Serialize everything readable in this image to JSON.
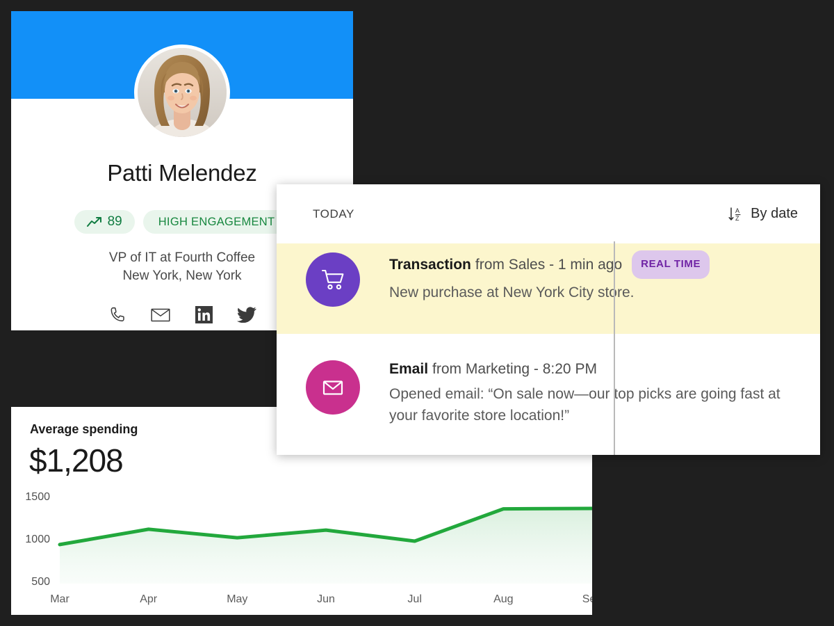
{
  "profile": {
    "name": "Patti Melendez",
    "score_badge": {
      "icon": "trend-up-icon",
      "value": "89"
    },
    "engagement_badge": "HIGH ENGAGEMENT",
    "title_line": "VP of IT at Fourth Coffee",
    "location_line": "New York, New York",
    "banner_color": "#1290f8",
    "badge_text_color": "#107c41",
    "badge_bg_color": "#e9f5ec",
    "social": [
      {
        "name": "phone-icon",
        "label": "Call"
      },
      {
        "name": "email-icon",
        "label": "Email"
      },
      {
        "name": "linkedin-icon",
        "label": "LinkedIn"
      },
      {
        "name": "twitter-icon",
        "label": "Twitter"
      }
    ]
  },
  "timeline": {
    "group_label": "TODAY",
    "sort": {
      "icon": "sort-az-descending-icon",
      "label": "By date"
    },
    "events": [
      {
        "icon": "shopping-cart-icon",
        "icon_color": "#6b3fc4",
        "type": "Transaction",
        "meta": "from Sales - 1 min ago",
        "chip": "REAL TIME",
        "chip_bg": "#ddc7ec",
        "chip_color": "#7024a5",
        "description": "New purchase at New York City store.",
        "highlighted": true,
        "highlight_color": "#fcf6cd"
      },
      {
        "icon": "envelope-icon",
        "icon_color": "#c9308e",
        "type": "Email",
        "meta": "from Marketing - 8:20 PM",
        "chip": "",
        "description": "Opened email: “On sale now—our top picks are going fast at your favorite store location!”",
        "highlighted": false
      }
    ]
  },
  "chart_card": {
    "title": "Average spending",
    "kpi": "$1,208"
  },
  "chart_data": {
    "type": "area",
    "title": "Average spending",
    "xlabel": "",
    "ylabel": "",
    "categories": [
      "Mar",
      "Apr",
      "May",
      "Jun",
      "Jul",
      "Aug",
      "Sep"
    ],
    "values": [
      960,
      1140,
      1040,
      1130,
      1000,
      1380,
      1385
    ],
    "ylim": [
      500,
      1500
    ],
    "yticks": [
      500,
      1000,
      1500
    ],
    "ytick_labels": [
      "500",
      "1000",
      "1500"
    ],
    "line_color": "#22a83c",
    "fill_color": "#e9f5ec",
    "grid": false,
    "legend": "none"
  }
}
